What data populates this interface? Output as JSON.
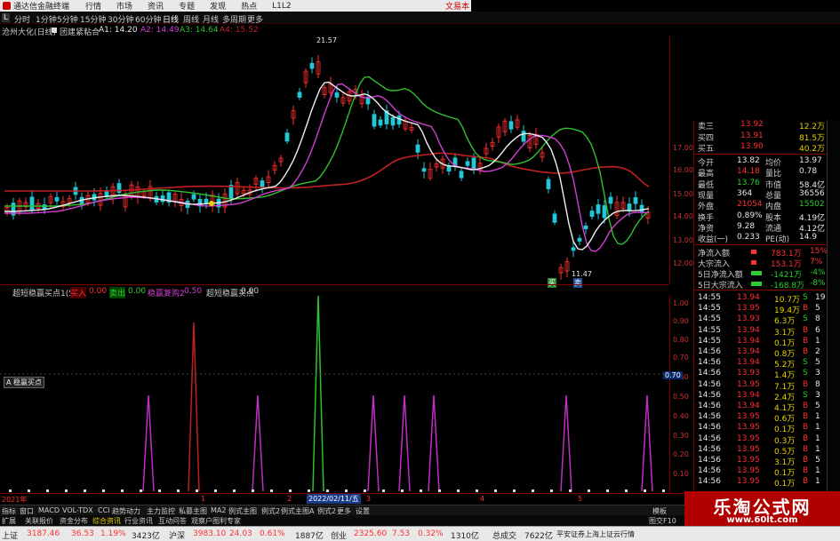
{
  "top_bar": {
    "app_title": "通达信金融终端",
    "menus": [
      "行情",
      "市场",
      "资讯",
      "专题",
      "发现",
      "热点",
      "L1L2"
    ],
    "right_label": "文易本",
    "back_label": "L"
  },
  "menu_bar": {
    "periods": [
      "分时",
      "1分钟",
      "5分钟",
      "15分钟",
      "30分钟",
      "60分钟",
      "日线",
      "周线",
      "月线",
      "多周期",
      "更多"
    ],
    "active_index": 6
  },
  "title_bar": {
    "stock": "沧州大化(日线)",
    "label": "团建紧粘合",
    "a1": "A1: 14.20",
    "a2": "A2: 14.49",
    "a3": "A3: 14.64",
    "a4": "A4: 15.52"
  },
  "price_axis": [
    "17.00",
    "16.00",
    "15.00",
    "14.00",
    "13.00",
    "12.00"
  ],
  "price_annotations": {
    "high": "21.57",
    "low": "11.47",
    "buy_tag": "买",
    "sell_tag": "卖"
  },
  "indicator": {
    "title": "超短稳赢买点1(5)",
    "buy_label": "买入",
    "buy_value": "0.00",
    "sell_label": "卖出",
    "sell_value": "0.00",
    "stable_label": "稳赢复购2",
    "stable_value": "0.50",
    "title2": "超短稳赢买点",
    "title2_value": "0.00",
    "tag": "A 稳赢买点",
    "cursor_value": "0.70",
    "axis": [
      "1.00",
      "0.90",
      "0.80",
      "0.70",
      "0.60",
      "0.50",
      "0.40",
      "0.30",
      "0.20",
      "0.10"
    ]
  },
  "date_bar": {
    "year": "2021年",
    "marks": [
      "1",
      "2",
      "3",
      "4",
      "5"
    ],
    "highlight": "2022/02/11/五"
  },
  "tabs": {
    "row1": [
      "指标",
      "窗口",
      "MACD",
      "VOL-TDX",
      "CCI",
      "趋势动力",
      "主力监控",
      "私募主图",
      "MA2",
      "例式主图",
      "例式2",
      "例式主图A",
      "例式2",
      "更多",
      "设置"
    ],
    "row2": [
      "扩展",
      "关联报价",
      "资金分布",
      "综合资讯",
      "行业资讯",
      "互动问答",
      "观察户图利专家"
    ],
    "right_tabs": [
      "模板",
      "图交F10"
    ]
  },
  "quote": {
    "order_book": [
      {
        "label": "卖三",
        "price": "13.92",
        "vol": "12.2万"
      },
      {
        "label": "买四",
        "price": "13.91",
        "vol": "81.5万"
      },
      {
        "label": "买五",
        "price": "13.90",
        "vol": "40.2万"
      }
    ],
    "stats": [
      {
        "l1": "今开",
        "v1": "13.82",
        "l2": "均价",
        "v2": "13.97"
      },
      {
        "l1": "最高",
        "v1": "14.18",
        "l2": "量比",
        "v2": "0.78"
      },
      {
        "l1": "最低",
        "v1": "13.76",
        "l2": "市值",
        "v2": "58.4亿"
      },
      {
        "l1": "现量",
        "v1": "364",
        "l2": "总量",
        "v2": "36556"
      },
      {
        "l1": "外盘",
        "v1": "21054",
        "l2": "内盘",
        "v2": "15502"
      },
      {
        "l1": "换手",
        "v1": "0.89%",
        "l2": "股本",
        "v2": "4.19亿"
      },
      {
        "l1": "净资",
        "v1": "9.28",
        "l2": "流通",
        "v2": "4.12亿"
      },
      {
        "l1": "收益(一)",
        "v1": "0.233",
        "l2": "PE(动)",
        "v2": "14.9"
      }
    ],
    "flows": [
      {
        "label": "净流入额",
        "value": "783.1万",
        "pct": "15%"
      },
      {
        "label": "大宗流入",
        "value": "153.1万",
        "pct": "7%"
      },
      {
        "label": "5日净流入额",
        "value": "-1421万",
        "pct": "-4%"
      },
      {
        "label": "5日大宗流入",
        "value": "-168.8万",
        "pct": "-8%"
      }
    ],
    "ticks": [
      {
        "t": "14:55",
        "p": "13.94",
        "v": "10.7万",
        "s": "S",
        "n": "19"
      },
      {
        "t": "14:55",
        "p": "13.95",
        "v": "19.4万",
        "s": "B",
        "n": "5"
      },
      {
        "t": "14:55",
        "p": "13.93",
        "v": "6.3万",
        "s": "S",
        "n": "8"
      },
      {
        "t": "14:55",
        "p": "13.94",
        "v": "3.1万",
        "s": "B",
        "n": "6"
      },
      {
        "t": "14:55",
        "p": "13.94",
        "v": "0.1万",
        "s": "B",
        "n": "1"
      },
      {
        "t": "14:56",
        "p": "13.94",
        "v": "0.8万",
        "s": "B",
        "n": "2"
      },
      {
        "t": "14:56",
        "p": "13.94",
        "v": "5.2万",
        "s": "S",
        "n": "5"
      },
      {
        "t": "14:56",
        "p": "13.93",
        "v": "1.4万",
        "s": "S",
        "n": "3"
      },
      {
        "t": "14:56",
        "p": "13.95",
        "v": "7.1万",
        "s": "B",
        "n": "8"
      },
      {
        "t": "14:56",
        "p": "13.94",
        "v": "2.4万",
        "s": "S",
        "n": "3"
      },
      {
        "t": "14:56",
        "p": "13.94",
        "v": "4.1万",
        "s": "B",
        "n": "5"
      },
      {
        "t": "14:56",
        "p": "13.95",
        "v": "0.6万",
        "s": "B",
        "n": "1"
      },
      {
        "t": "14:56",
        "p": "13.95",
        "v": "0.1万",
        "s": "B",
        "n": "1"
      },
      {
        "t": "14:56",
        "p": "13.95",
        "v": "0.3万",
        "s": "B",
        "n": "1"
      },
      {
        "t": "14:56",
        "p": "13.95",
        "v": "0.5万",
        "s": "B",
        "n": "1"
      },
      {
        "t": "14:56",
        "p": "13.95",
        "v": "3.1万",
        "s": "B",
        "n": "5"
      },
      {
        "t": "14:56",
        "p": "13.95",
        "v": "0.1万",
        "s": "B",
        "n": "1"
      },
      {
        "t": "14:56",
        "p": "13.95",
        "v": "0.1万",
        "s": "B",
        "n": "1"
      }
    ]
  },
  "status": {
    "sh_label": "上证",
    "sh_value": "3187.46",
    "sh_chg": "36.53",
    "sh_pct": "1.19%",
    "sh_amt": "3423亿",
    "sz_label": "沪深",
    "sz_value": "3983.10",
    "sz_chg": "24.03",
    "sz_pct": "0.61%",
    "sz_amt": "1887亿",
    "cy_label": "创业",
    "cy_value": "2325.60",
    "cy_chg": "7.53",
    "cy_pct": "0.32%",
    "cy_amt": "1310亿",
    "total_label": "总成交",
    "total_value": "7622亿",
    "broker": "平安证券上海上证云行情"
  },
  "watermark": {
    "cn": "乐淘公式网",
    "url": "www.60lt.com"
  },
  "colors": {
    "up": "#ff3030",
    "down": "#2ecc2e",
    "ma_white": "#f0f0f0",
    "ma_purple": "#d040d0",
    "ma_green": "#30c030",
    "ma_red": "#c02020"
  }
}
